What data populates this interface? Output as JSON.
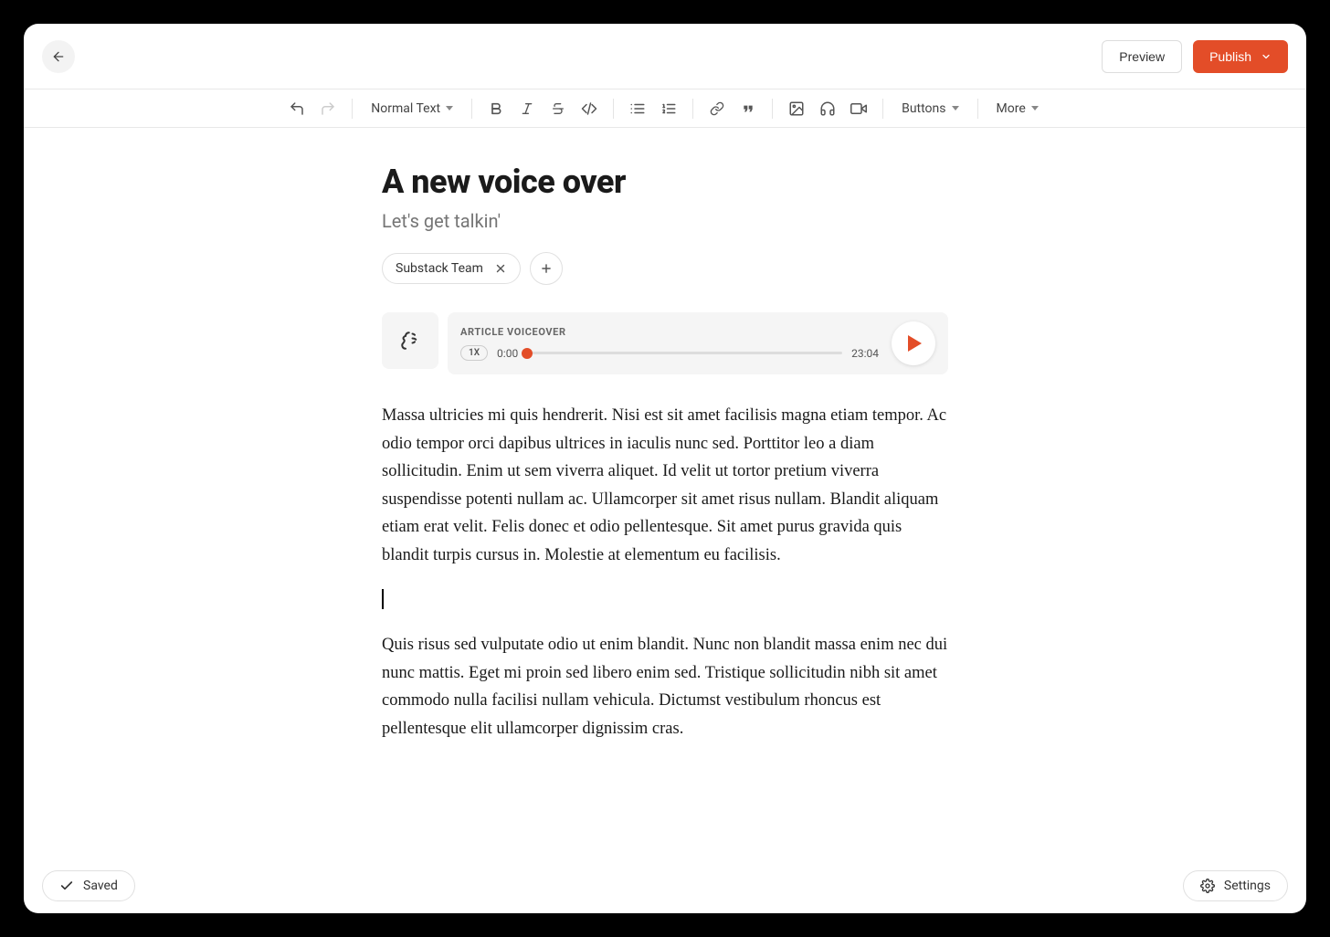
{
  "header": {
    "preview_label": "Preview",
    "publish_label": "Publish"
  },
  "toolbar": {
    "style_label": "Normal Text",
    "buttons_label": "Buttons",
    "more_label": "More"
  },
  "post": {
    "title": "A new voice over",
    "subtitle": "Let's get talkin'",
    "tag": "Substack Team"
  },
  "audio": {
    "label": "ARTICLE VOICEOVER",
    "speed": "1X",
    "current_time": "0:00",
    "total_time": "23:04"
  },
  "body": {
    "p1": "Massa ultricies mi quis hendrerit. Nisi est sit amet facilisis magna etiam tempor. Ac odio tempor orci dapibus ultrices in iaculis nunc sed. Porttitor leo a diam sollicitudin. Enim ut sem viverra aliquet. Id velit ut tortor pretium viverra suspendisse potenti nullam ac. Ullamcorper sit amet risus nullam. Blandit aliquam etiam erat velit. Felis donec et odio pellentesque. Sit amet purus gravida quis blandit turpis cursus in. Molestie at elementum eu facilisis.",
    "p2": "Quis risus sed vulputate odio ut enim blandit. Nunc non blandit massa enim nec dui nunc mattis. Eget mi proin sed libero enim sed. Tristique sollicitudin nibh sit amet commodo nulla facilisi nullam vehicula. Dictumst vestibulum rhoncus est pellentesque elit ullamcorper dignissim cras."
  },
  "footer": {
    "saved_label": "Saved",
    "settings_label": "Settings"
  }
}
